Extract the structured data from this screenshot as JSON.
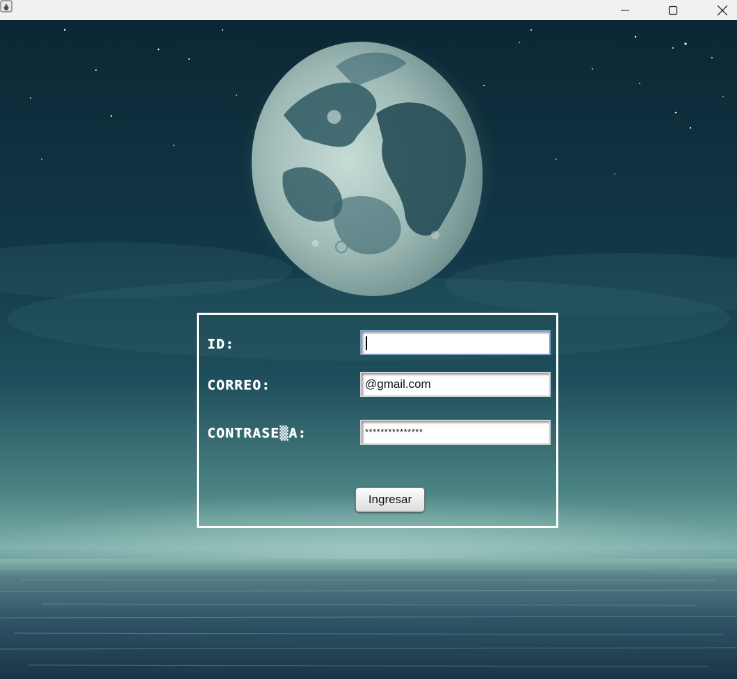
{
  "window": {
    "minimize_icon": "minimize-icon",
    "maximize_icon": "maximize-icon",
    "close_icon": "close-icon",
    "app_icon": "java-app-icon"
  },
  "form": {
    "id_label": "ID:",
    "correo_label": "CORREO:",
    "password_label": "CONTRASE▒A:",
    "id_value": "",
    "correo_value": "@gmail.com",
    "password_value": "***************",
    "submit_label": "Ingresar"
  },
  "colors": {
    "panel_border": "#ffffff",
    "label_text": "#ffffff",
    "titlebar": "#f1f1f1",
    "focus_border": "#7aa0c8"
  }
}
